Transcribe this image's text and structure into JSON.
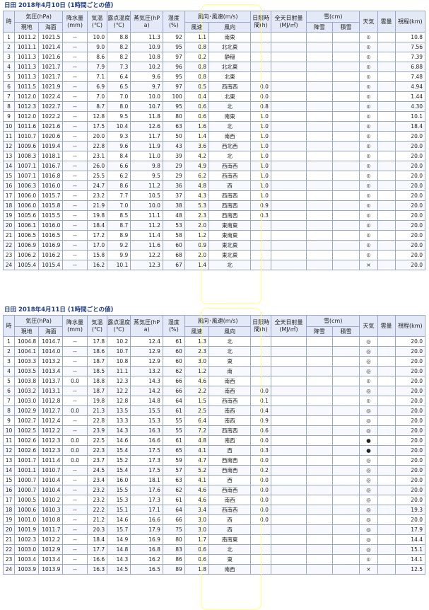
{
  "headers": {
    "hour": "時",
    "pressure": "気圧(hPa)",
    "pressure_local": "現地",
    "pressure_sea": "海面",
    "precip": "降水量(mm)",
    "temp": "気温(℃)",
    "dew": "露点温度(℃)",
    "vapor": "蒸気圧(hPa)",
    "humidity": "湿度(%)",
    "wind": "風向･風速(m/s)",
    "wind_speed": "風速",
    "wind_dir": "風向",
    "sun": "日照時間(h)",
    "rad": "全天日射量(MJ/㎡)",
    "snow": "雪(cm)",
    "snowfall": "降雪",
    "snowdepth": "積雪",
    "weather": "天気",
    "cloud": "雲量",
    "vis": "視程(km)"
  },
  "days": [
    {
      "title": "日田  2018年4月10日  (1時間ごとの値)",
      "rows": [
        [
          "1",
          "1011.2",
          "1021.5",
          "--",
          "10.0",
          "8.8",
          "11.3",
          "92",
          "1.1",
          "南東",
          "",
          "",
          "",
          "",
          "mist",
          "",
          "10.8"
        ],
        [
          "2",
          "1011.1",
          "1021.4",
          "--",
          "9.0",
          "8.2",
          "10.9",
          "95",
          "0.8",
          "北北東",
          "",
          "",
          "",
          "",
          "mist",
          "",
          "7.56"
        ],
        [
          "3",
          "1011.3",
          "1021.6",
          "--",
          "8.6",
          "8.2",
          "10.8",
          "97",
          "0.2",
          "静穏",
          "",
          "",
          "",
          "",
          "mist",
          "",
          "7.39"
        ],
        [
          "4",
          "1011.3",
          "1021.7",
          "--",
          "7.9",
          "7.3",
          "10.2",
          "96",
          "0.8",
          "北北東",
          "",
          "",
          "",
          "",
          "mist",
          "",
          "6.88"
        ],
        [
          "5",
          "1011.3",
          "1021.7",
          "--",
          "7.1",
          "6.4",
          "9.6",
          "95",
          "0.8",
          "北東",
          "",
          "",
          "",
          "",
          "mist",
          "",
          "7.48"
        ],
        [
          "6",
          "1011.5",
          "1021.9",
          "--",
          "6.9",
          "6.5",
          "9.7",
          "97",
          "0.5",
          "西南西",
          "0.0",
          "",
          "",
          "",
          "mist",
          "",
          "4.94"
        ],
        [
          "7",
          "1012.0",
          "1022.4",
          "--",
          "7.0",
          "7.0",
          "10.0",
          "100",
          "0.4",
          "北東",
          "0.0",
          "",
          "",
          "",
          "mist",
          "",
          "1.44"
        ],
        [
          "8",
          "1012.3",
          "1022.7",
          "--",
          "8.7",
          "8.0",
          "10.7",
          "95",
          "0.6",
          "北",
          "0.8",
          "",
          "",
          "",
          "mist",
          "",
          "4.30"
        ],
        [
          "9",
          "1012.0",
          "1022.2",
          "--",
          "12.8",
          "9.5",
          "11.8",
          "80",
          "0.6",
          "南東",
          "1.0",
          "",
          "",
          "",
          "mist",
          "",
          "10.1"
        ],
        [
          "10",
          "1011.6",
          "1021.6",
          "--",
          "17.5",
          "10.4",
          "12.6",
          "63",
          "1.6",
          "北",
          "1.0",
          "",
          "",
          "",
          "mist",
          "",
          "18.4"
        ],
        [
          "11",
          "1010.7",
          "1020.6",
          "--",
          "20.0",
          "9.3",
          "11.7",
          "50",
          "1.4",
          "南西",
          "1.0",
          "",
          "",
          "",
          "mist",
          "",
          "20.0"
        ],
        [
          "12",
          "1009.6",
          "1019.4",
          "--",
          "22.8",
          "9.6",
          "11.9",
          "43",
          "3.6",
          "西北西",
          "1.0",
          "",
          "",
          "",
          "mist",
          "",
          "20.0"
        ],
        [
          "13",
          "1008.3",
          "1018.1",
          "--",
          "23.1",
          "8.4",
          "11.0",
          "39",
          "4.2",
          "北",
          "1.0",
          "",
          "",
          "",
          "mist",
          "",
          "20.0"
        ],
        [
          "14",
          "1007.1",
          "1016.7",
          "--",
          "26.0",
          "6.6",
          "9.8",
          "29",
          "4.9",
          "西南西",
          "1.0",
          "",
          "",
          "",
          "mist",
          "",
          "20.0"
        ],
        [
          "15",
          "1007.1",
          "1016.8",
          "--",
          "25.5",
          "6.2",
          "9.5",
          "29",
          "6.2",
          "西南西",
          "1.0",
          "",
          "",
          "",
          "mist",
          "",
          "20.0"
        ],
        [
          "16",
          "1006.3",
          "1016.0",
          "--",
          "24.7",
          "8.6",
          "11.2",
          "36",
          "4.8",
          "西",
          "1.0",
          "",
          "",
          "",
          "mist",
          "",
          "20.0"
        ],
        [
          "17",
          "1006.0",
          "1015.7",
          "--",
          "23.2",
          "7.7",
          "10.5",
          "37",
          "4.3",
          "西南西",
          "1.0",
          "",
          "",
          "",
          "mist",
          "",
          "20.0"
        ],
        [
          "18",
          "1006.0",
          "1015.8",
          "--",
          "21.9",
          "7.0",
          "10.0",
          "38",
          "5.3",
          "西南西",
          "0.9",
          "",
          "",
          "",
          "mist",
          "",
          "20.0"
        ],
        [
          "19",
          "1005.6",
          "1015.5",
          "--",
          "19.8",
          "8.5",
          "11.1",
          "48",
          "2.3",
          "西南西",
          "0.3",
          "",
          "",
          "",
          "mist",
          "",
          "20.0"
        ],
        [
          "20",
          "1006.1",
          "1016.0",
          "--",
          "18.4",
          "8.7",
          "11.2",
          "53",
          "2.0",
          "東南東",
          "",
          "",
          "",
          "",
          "mist",
          "",
          "20.0"
        ],
        [
          "21",
          "1006.5",
          "1016.5",
          "--",
          "17.2",
          "8.9",
          "11.4",
          "58",
          "1.2",
          "東南東",
          "",
          "",
          "",
          "",
          "mist",
          "",
          "20.0"
        ],
        [
          "22",
          "1006.9",
          "1016.9",
          "--",
          "17.0",
          "9.2",
          "11.6",
          "60",
          "0.9",
          "東北東",
          "",
          "",
          "",
          "",
          "mist",
          "",
          "20.0"
        ],
        [
          "23",
          "1006.2",
          "1016.2",
          "--",
          "15.8",
          "9.9",
          "12.2",
          "68",
          "2.0",
          "東北東",
          "",
          "",
          "",
          "",
          "mist",
          "",
          "20.0"
        ],
        [
          "24",
          "1005.4",
          "1015.4",
          "--",
          "16.2",
          "10.1",
          "12.3",
          "67",
          "1.4",
          "北",
          "",
          "",
          "",
          "",
          "unknown",
          "",
          "20.0"
        ]
      ]
    },
    {
      "title": "日田  2018年4月11日  (1時間ごとの値)",
      "rows": [
        [
          "1",
          "1004.8",
          "1014.7",
          "--",
          "17.8",
          "10.2",
          "12.4",
          "61",
          "1.3",
          "北",
          "",
          "",
          "",
          "",
          "cloudy",
          "",
          "20.0"
        ],
        [
          "2",
          "1004.1",
          "1014.0",
          "--",
          "18.6",
          "10.7",
          "12.9",
          "60",
          "2.3",
          "北",
          "",
          "",
          "",
          "",
          "cloudy",
          "",
          "20.0"
        ],
        [
          "3",
          "1003.3",
          "1013.2",
          "--",
          "18.7",
          "10.8",
          "12.9",
          "60",
          "3.0",
          "東",
          "",
          "",
          "",
          "",
          "cloudy",
          "",
          "20.0"
        ],
        [
          "4",
          "1003.5",
          "1013.4",
          "--",
          "18.5",
          "11.1",
          "13.2",
          "62",
          "1.2",
          "南",
          "",
          "",
          "",
          "",
          "cloudy",
          "",
          "20.0"
        ],
        [
          "5",
          "1003.8",
          "1013.7",
          "0.0",
          "18.8",
          "12.3",
          "14.3",
          "66",
          "4.6",
          "南西",
          "",
          "",
          "",
          "",
          "mist",
          "",
          "20.0"
        ],
        [
          "6",
          "1003.2",
          "1013.1",
          "--",
          "18.7",
          "12.2",
          "14.2",
          "66",
          "2.2",
          "南西",
          "0.0",
          "",
          "",
          "",
          "cloudy",
          "",
          "20.0"
        ],
        [
          "7",
          "1003.0",
          "1012.8",
          "--",
          "19.8",
          "12.8",
          "14.8",
          "64",
          "1.5",
          "西南西",
          "0.1",
          "",
          "",
          "",
          "mist",
          "",
          "20.0"
        ],
        [
          "8",
          "1002.9",
          "1012.7",
          "0.0",
          "21.3",
          "13.5",
          "15.5",
          "61",
          "2.5",
          "南西",
          "0.4",
          "",
          "",
          "",
          "cloudy",
          "",
          "20.0"
        ],
        [
          "9",
          "1002.7",
          "1012.4",
          "--",
          "22.8",
          "13.3",
          "15.3",
          "55",
          "6.4",
          "南西",
          "0.9",
          "",
          "",
          "",
          "cloudy",
          "",
          "20.0"
        ],
        [
          "10",
          "1002.5",
          "1012.2",
          "--",
          "23.9",
          "14.3",
          "16.3",
          "55",
          "7.2",
          "西南西",
          "0.6",
          "",
          "",
          "",
          "cloudy",
          "",
          "20.0"
        ],
        [
          "11",
          "1002.6",
          "1012.3",
          "0.0",
          "22.5",
          "14.6",
          "16.6",
          "61",
          "4.8",
          "南西",
          "0.0",
          "",
          "",
          "",
          "rain",
          "",
          "20.0"
        ],
        [
          "12",
          "1002.6",
          "1012.3",
          "0.0",
          "22.3",
          "15.4",
          "17.5",
          "65",
          "4.1",
          "西",
          "0.3",
          "",
          "",
          "",
          "rain",
          "",
          "20.0"
        ],
        [
          "13",
          "1001.7",
          "1011.4",
          "0.0",
          "23.7",
          "15.2",
          "17.3",
          "59",
          "4.7",
          "西南西",
          "0.0",
          "",
          "",
          "",
          "cloudy",
          "",
          "20.0"
        ],
        [
          "14",
          "1001.1",
          "1010.7",
          "--",
          "24.5",
          "15.4",
          "17.5",
          "57",
          "5.2",
          "西南西",
          "0.2",
          "",
          "",
          "",
          "cloudy",
          "",
          "20.0"
        ],
        [
          "15",
          "1000.7",
          "1010.4",
          "--",
          "23.4",
          "16.0",
          "18.1",
          "63",
          "4.1",
          "西",
          "0.0",
          "",
          "",
          "",
          "cloudy",
          "",
          "20.0"
        ],
        [
          "16",
          "1000.7",
          "1010.4",
          "--",
          "23.2",
          "15.5",
          "17.6",
          "62",
          "4.6",
          "西南西",
          "0.0",
          "",
          "",
          "",
          "cloudy",
          "",
          "20.0"
        ],
        [
          "17",
          "1000.5",
          "1010.2",
          "--",
          "23.2",
          "15.3",
          "17.3",
          "61",
          "4.6",
          "南西",
          "0.0",
          "",
          "",
          "",
          "cloudy",
          "",
          "20.0"
        ],
        [
          "18",
          "1000.6",
          "1010.3",
          "--",
          "22.2",
          "15.1",
          "17.1",
          "64",
          "3.4",
          "西南西",
          "0.0",
          "",
          "",
          "",
          "cloudy",
          "",
          "19.3"
        ],
        [
          "19",
          "1001.0",
          "1010.8",
          "--",
          "21.2",
          "14.6",
          "16.6",
          "66",
          "3.0",
          "西",
          "0.0",
          "",
          "",
          "",
          "cloudy",
          "",
          "20.0"
        ],
        [
          "20",
          "1001.9",
          "1011.7",
          "--",
          "20.3",
          "15.7",
          "17.9",
          "75",
          "3.0",
          "西",
          "",
          "",
          "",
          "",
          "cloudy",
          "",
          "17.9"
        ],
        [
          "21",
          "1002.3",
          "1012.2",
          "--",
          "18.4",
          "14.9",
          "16.9",
          "80",
          "1.7",
          "南南東",
          "",
          "",
          "",
          "",
          "cloudy",
          "",
          "14.4"
        ],
        [
          "22",
          "1003.0",
          "1012.9",
          "--",
          "17.7",
          "14.8",
          "16.8",
          "83",
          "0.6",
          "北",
          "",
          "",
          "",
          "",
          "cloudy",
          "",
          "15.1"
        ],
        [
          "23",
          "1003.4",
          "1013.4",
          "--",
          "16.6",
          "14.3",
          "16.2",
          "86",
          "0.6",
          "東",
          "",
          "",
          "",
          "",
          "mist",
          "",
          "14.1"
        ],
        [
          "24",
          "1003.9",
          "1013.9",
          "--",
          "16.3",
          "14.5",
          "16.5",
          "89",
          "1.8",
          "南西",
          "",
          "",
          "",
          "",
          "unknown",
          "",
          "12.5"
        ]
      ]
    }
  ],
  "weather_symbols": {
    "mist": "⦶",
    "cloudy": "◎",
    "rain": "●",
    "unknown": "×"
  }
}
